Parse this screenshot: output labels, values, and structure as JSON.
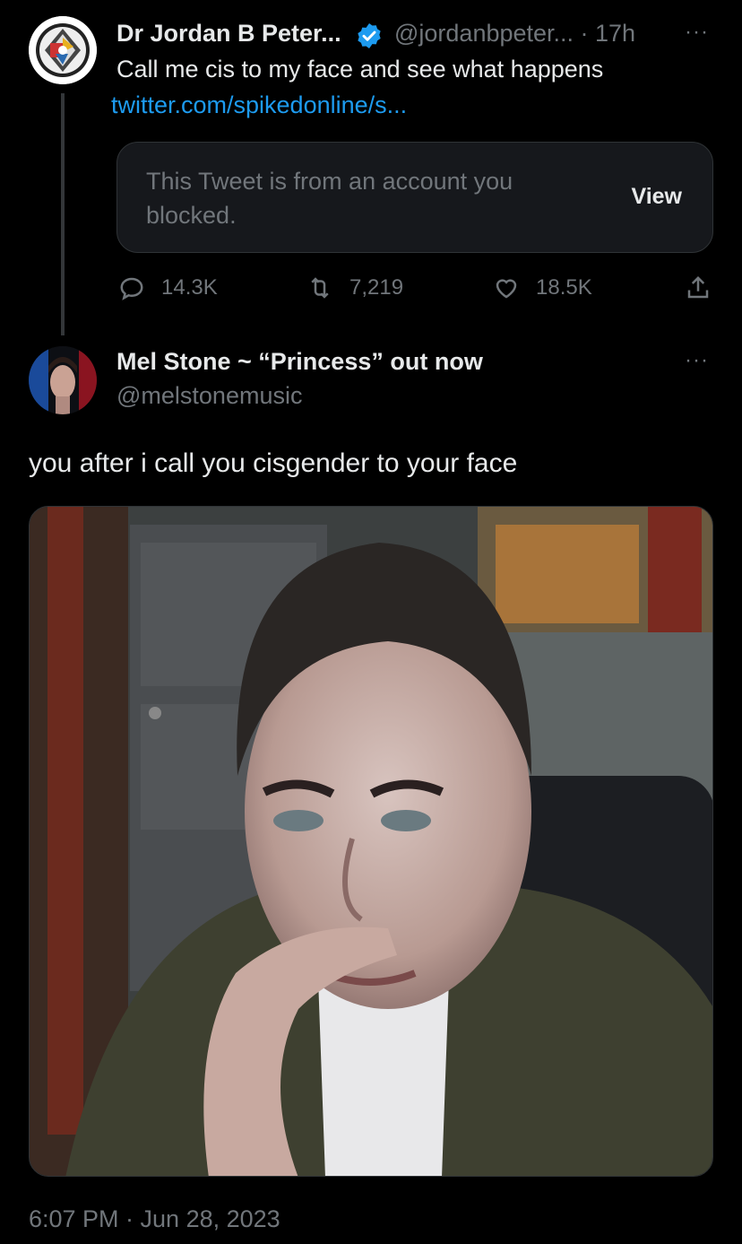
{
  "original_tweet": {
    "display_name": "Dr Jordan B Peter...",
    "handle_time": "@jordanbpeter... · 17h",
    "text": "Call me cis to my face and see what happens",
    "link": "twitter.com/spikedonline/s...",
    "blocked_card": {
      "message": "This Tweet is from an account you blocked.",
      "view_label": "View"
    },
    "stats": {
      "replies": "14.3K",
      "retweets": "7,219",
      "likes": "18.5K"
    }
  },
  "reply_tweet": {
    "display_name": "Mel Stone ~ “Princess” out now",
    "handle": "@melstonemusic",
    "text": "you after i call you cisgender to your face",
    "timestamp": "6:07 PM · Jun 28, 2023"
  },
  "more_label": "···",
  "colors": {
    "background": "#000000",
    "text": "#e7e9ea",
    "muted": "#71767b",
    "link": "#1d9bf0",
    "card": "#16181c"
  }
}
